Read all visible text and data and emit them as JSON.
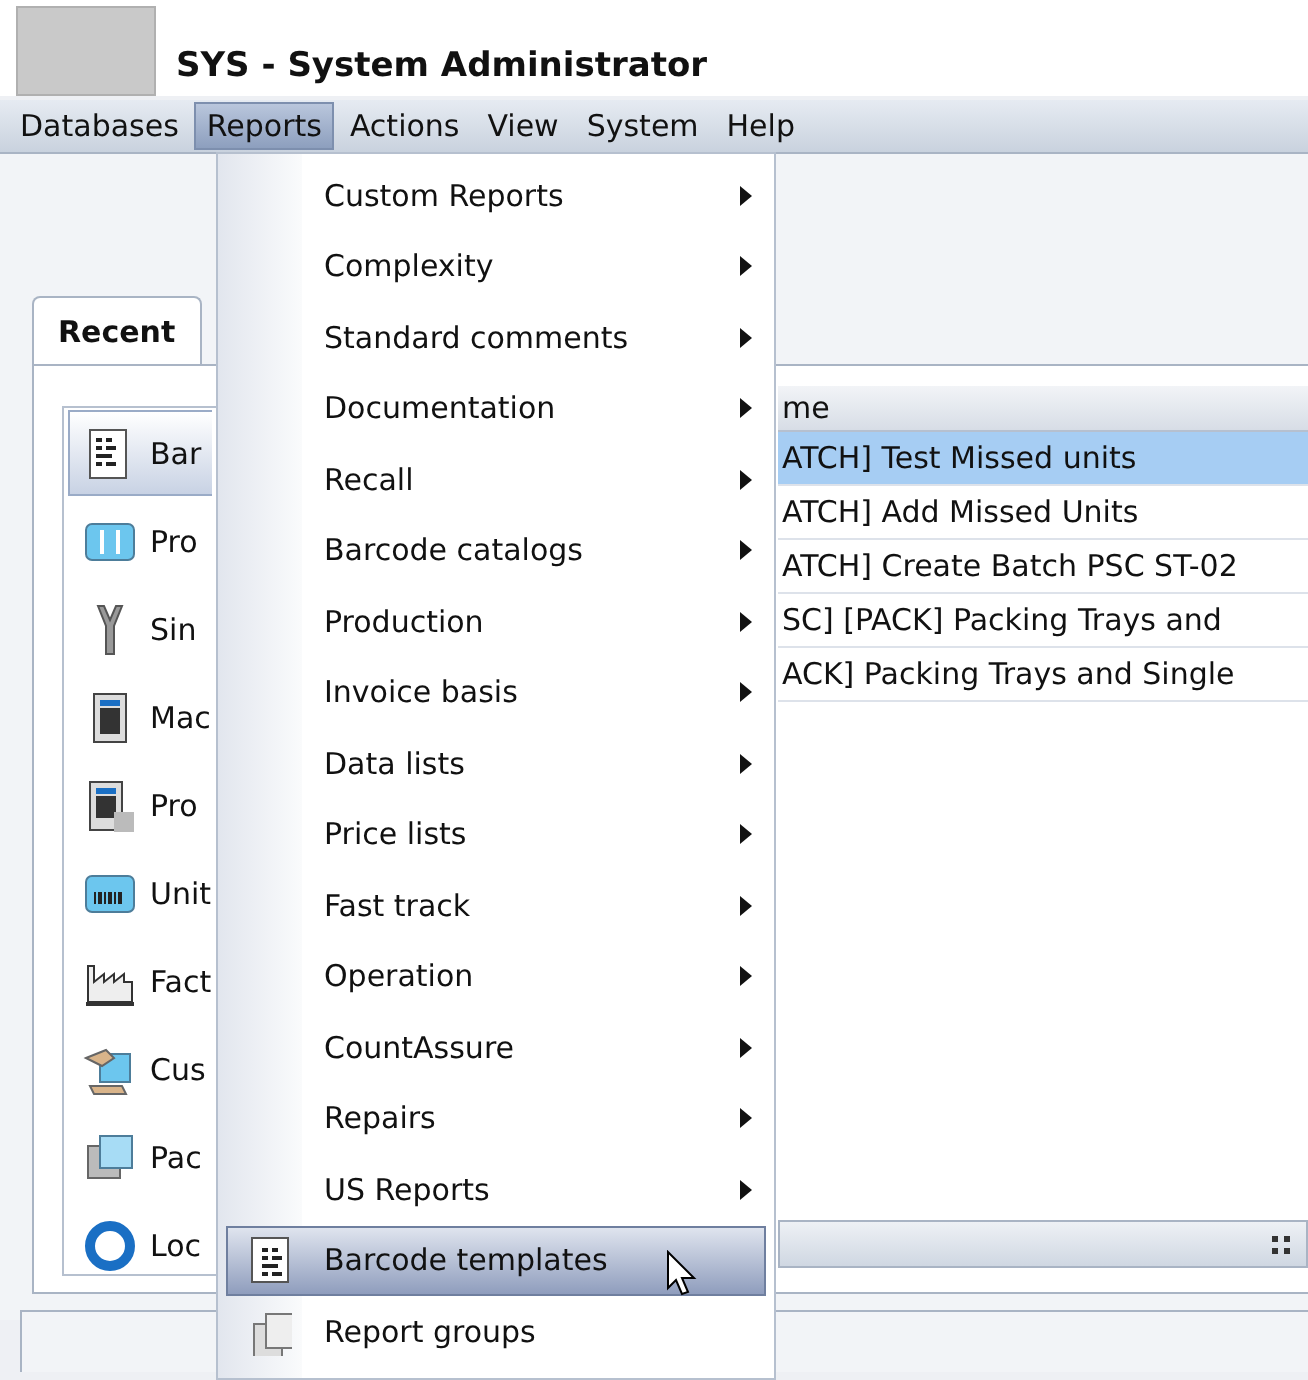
{
  "header": {
    "title": "SYS - System Administrator"
  },
  "menubar": [
    {
      "label": "Databases",
      "selected": false
    },
    {
      "label": "Reports",
      "selected": true
    },
    {
      "label": "Actions",
      "selected": false
    },
    {
      "label": "View",
      "selected": false
    },
    {
      "label": "System",
      "selected": false
    },
    {
      "label": "Help",
      "selected": false
    }
  ],
  "tabs": [
    {
      "label": "Recent",
      "selected": true
    }
  ],
  "recent_list": [
    {
      "label": "Bar",
      "selected": true
    },
    {
      "label": "Pro",
      "selected": false
    },
    {
      "label": "Sin",
      "selected": false
    },
    {
      "label": "Mac",
      "selected": false
    },
    {
      "label": "Pro",
      "selected": false
    },
    {
      "label": "Unit",
      "selected": false
    },
    {
      "label": "Fact",
      "selected": false
    },
    {
      "label": "Cus",
      "selected": false
    },
    {
      "label": "Pac",
      "selected": false
    },
    {
      "label": "Loc",
      "selected": false
    }
  ],
  "table": {
    "columns": [
      "me"
    ],
    "rows": [
      {
        "cells": [
          "ATCH] Test Missed units"
        ],
        "selected": true
      },
      {
        "cells": [
          "ATCH] Add Missed Units"
        ],
        "selected": false
      },
      {
        "cells": [
          "ATCH] Create Batch PSC ST-02"
        ],
        "selected": false
      },
      {
        "cells": [
          "SC] [PACK] Packing Trays and"
        ],
        "selected": false
      },
      {
        "cells": [
          "ACK] Packing Trays and Single"
        ],
        "selected": false
      }
    ]
  },
  "menu": {
    "items": [
      {
        "label": "Custom Reports",
        "kind": "submenu",
        "selected": false
      },
      {
        "label": "Complexity",
        "kind": "submenu",
        "selected": false
      },
      {
        "label": "Standard comments",
        "kind": "submenu",
        "selected": false
      },
      {
        "label": "Documentation",
        "kind": "submenu",
        "selected": false
      },
      {
        "label": "Recall",
        "kind": "submenu",
        "selected": false
      },
      {
        "label": "Barcode catalogs",
        "kind": "submenu",
        "selected": false
      },
      {
        "label": "Production",
        "kind": "submenu",
        "selected": false
      },
      {
        "label": "Invoice basis",
        "kind": "submenu",
        "selected": false
      },
      {
        "label": "Data lists",
        "kind": "submenu",
        "selected": false
      },
      {
        "label": "Price lists",
        "kind": "submenu",
        "selected": false
      },
      {
        "label": "Fast track",
        "kind": "submenu",
        "selected": false
      },
      {
        "label": "Operation",
        "kind": "submenu",
        "selected": false
      },
      {
        "label": "CountAssure",
        "kind": "submenu",
        "selected": false
      },
      {
        "label": "Repairs",
        "kind": "submenu",
        "selected": false
      },
      {
        "label": "US Reports",
        "kind": "submenu",
        "selected": false
      },
      {
        "label": "Barcode templates",
        "kind": "action",
        "selected": true
      },
      {
        "label": "Report groups",
        "kind": "action",
        "selected": false
      }
    ]
  }
}
